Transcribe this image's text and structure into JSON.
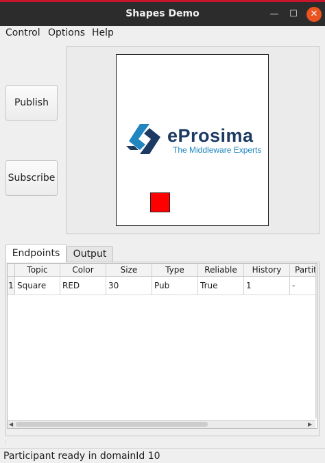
{
  "window": {
    "title": "Shapes Demo",
    "minimize_glyph": "—",
    "maximize_glyph": "☐",
    "close_glyph": "✕"
  },
  "menu": {
    "items": [
      "Control",
      "Options",
      "Help"
    ]
  },
  "actions": {
    "publish_label": "Publish",
    "subscribe_label": "Subscribe"
  },
  "canvas": {
    "logo_name": "eProsima",
    "logo_tagline": "The Middleware Experts",
    "shape_color": "#ff0000",
    "shape_kind": "square"
  },
  "tabs": [
    "Endpoints",
    "Output"
  ],
  "table": {
    "columns": [
      "Topic",
      "Color",
      "Size",
      "Type",
      "Reliable",
      "History",
      "Partiti"
    ],
    "rows": [
      {
        "index": "1",
        "cells": [
          "Square",
          "RED",
          "30",
          "Pub",
          "True",
          "1",
          "-"
        ]
      }
    ]
  },
  "status": {
    "text": "Participant ready in domainId 10"
  },
  "colors": {
    "titlebar": "#2c2c2c",
    "close_button": "#e95420",
    "logo_dark": "#1d3a63",
    "logo_light": "#1f86c0"
  }
}
